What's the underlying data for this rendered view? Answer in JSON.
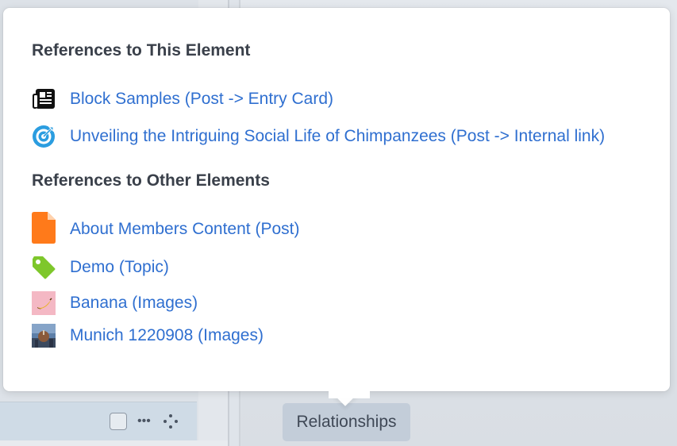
{
  "popover": {
    "incoming_heading": "References to This Element",
    "incoming": [
      {
        "label": "Block Samples (Post -> Entry Card)",
        "icon": "newspaper-icon"
      },
      {
        "label": "Unveiling the Intriguing Social Life of Chimpanzees (Post -> Internal link)",
        "icon": "target-icon"
      }
    ],
    "outgoing_heading": "References to Other Elements",
    "outgoing": [
      {
        "label": "About Members Content (Post)",
        "icon": "document-icon"
      },
      {
        "label": "Demo (Topic)",
        "icon": "tag-icon"
      },
      {
        "label": "Banana (Images)",
        "icon": "banana-thumbnail"
      },
      {
        "label": "Munich 1220908 (Images)",
        "icon": "munich-thumbnail"
      }
    ]
  },
  "toolbar": {
    "relationships_label": "Relationships",
    "more_label": "•••"
  },
  "colors": {
    "link": "#2f6fd0",
    "heading": "#3a404a",
    "document_icon": "#ff7a1a",
    "tag_icon": "#7ec72b",
    "target_icon": "#2b9de0"
  }
}
